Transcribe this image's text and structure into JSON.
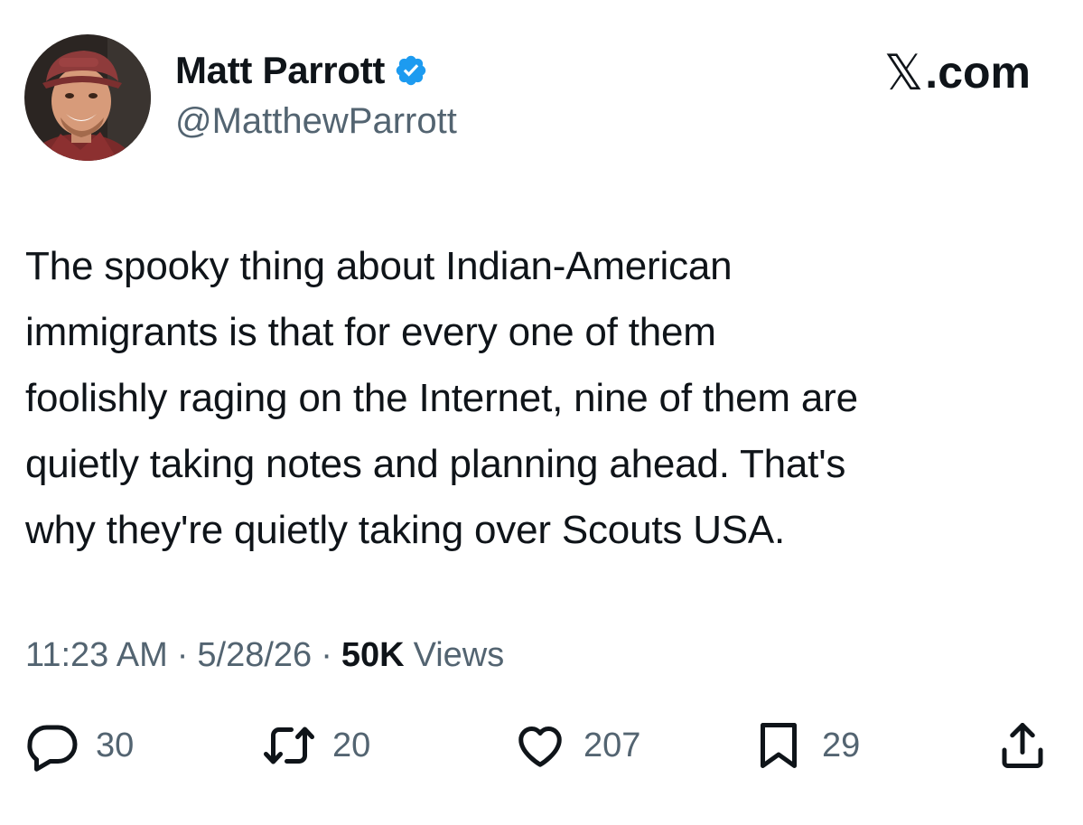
{
  "author": {
    "display_name": "Matt Parrott",
    "handle": "@MatthewParrott",
    "verified": true
  },
  "brand": {
    "x_glyph": "𝕏",
    "domain": ".com"
  },
  "tweet": {
    "text": "The spooky thing about Indian-American\nimmigrants is that for every one of them\nfoolishly raging on the Internet, nine of them are\nquietly taking notes and planning ahead. That's\nwhy they're quietly taking over Scouts USA."
  },
  "meta": {
    "time": "11:23 AM",
    "separator": "·",
    "date": "5/28/26",
    "views_count": "50K",
    "views_label": "Views"
  },
  "actions": {
    "replies": "30",
    "reposts": "20",
    "likes": "207",
    "bookmarks": "29"
  },
  "colors": {
    "text_primary": "#0f1419",
    "text_secondary": "#536471",
    "verified_blue": "#1d9bf0",
    "background": "#ffffff"
  },
  "icons": {
    "verified": "verified-badge-icon",
    "reply": "speech-bubble-icon",
    "repost": "repost-arrows-icon",
    "like": "heart-icon",
    "bookmark": "bookmark-icon",
    "share": "share-upload-icon"
  }
}
